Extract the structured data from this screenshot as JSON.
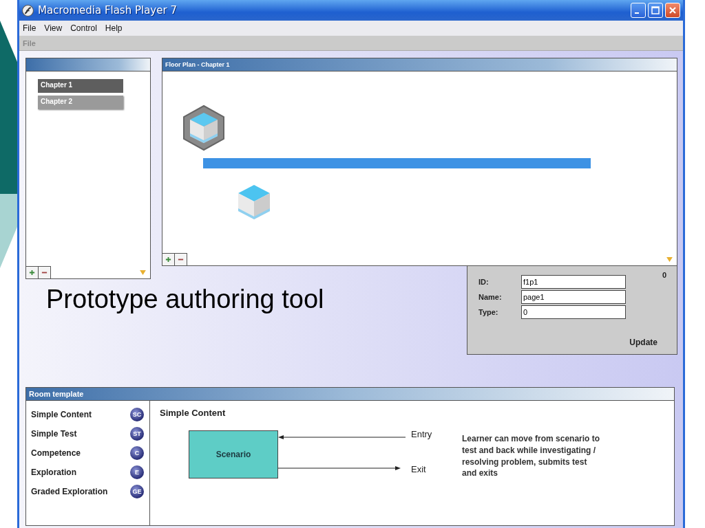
{
  "window": {
    "title": "Macromedia Flash Player 7"
  },
  "menu": [
    {
      "label": "File"
    },
    {
      "label": "View"
    },
    {
      "label": "Control"
    },
    {
      "label": "Help"
    }
  ],
  "toolbar": {
    "label": "File"
  },
  "chapters": [
    {
      "label": "Chapter 1",
      "selected": true
    },
    {
      "label": "Chapter 2",
      "selected": false
    }
  ],
  "floor_plan": {
    "title": "Floor Plan -  Chapter 1"
  },
  "caption": "Prototype authoring tool",
  "properties": {
    "counter": "0",
    "fields": [
      {
        "label": "ID:",
        "value": "f1p1"
      },
      {
        "label": "Name:",
        "value": "page1"
      },
      {
        "label": "Type:",
        "value": "0"
      }
    ],
    "button": "Update"
  },
  "room_template": {
    "title": "Room template",
    "templates": [
      {
        "label": "Simple Content",
        "badge": "SC"
      },
      {
        "label": "Simple Test",
        "badge": "ST"
      },
      {
        "label": "Competence",
        "badge": "C"
      },
      {
        "label": "Exploration",
        "badge": "E"
      },
      {
        "label": "Graded Exploration",
        "badge": "GE"
      }
    ],
    "detail": {
      "title": "Simple Content",
      "box": "Scenario",
      "entry": "Entry",
      "exit": "Exit",
      "description": "Learner can move from scenario to test and back while investigating  / resolving problem, submits test and exits"
    }
  }
}
